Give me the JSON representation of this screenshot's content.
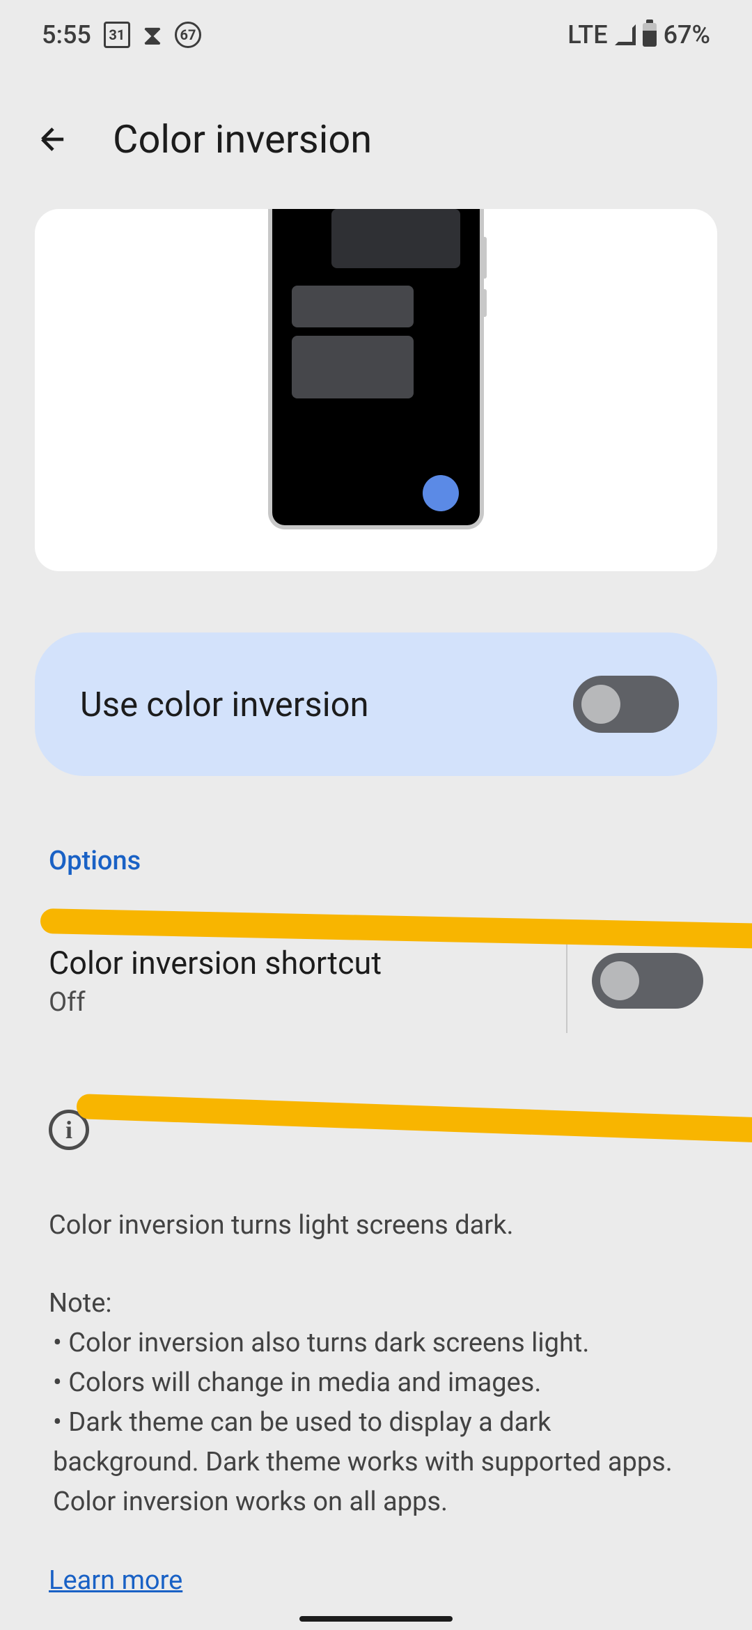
{
  "status": {
    "time": "5:55",
    "calendar_day": "31",
    "circle_num": "67",
    "network": "LTE",
    "battery": "67%"
  },
  "header": {
    "title": "Color inversion"
  },
  "main_toggle": {
    "label": "Use color inversion",
    "state": "off"
  },
  "options": {
    "header": "Options"
  },
  "shortcut": {
    "title": "Color inversion shortcut",
    "subtitle": "Off",
    "state": "off"
  },
  "info": {
    "summary": "Color inversion turns light screens dark.",
    "note_label": "Note:",
    "bullets": [
      "Color inversion also turns dark screens light.",
      "Colors will change in media and images.",
      "Dark theme can be used to display a dark background. Dark theme works with supported apps. Color inversion works on all apps."
    ],
    "learn_more": "Learn more"
  }
}
